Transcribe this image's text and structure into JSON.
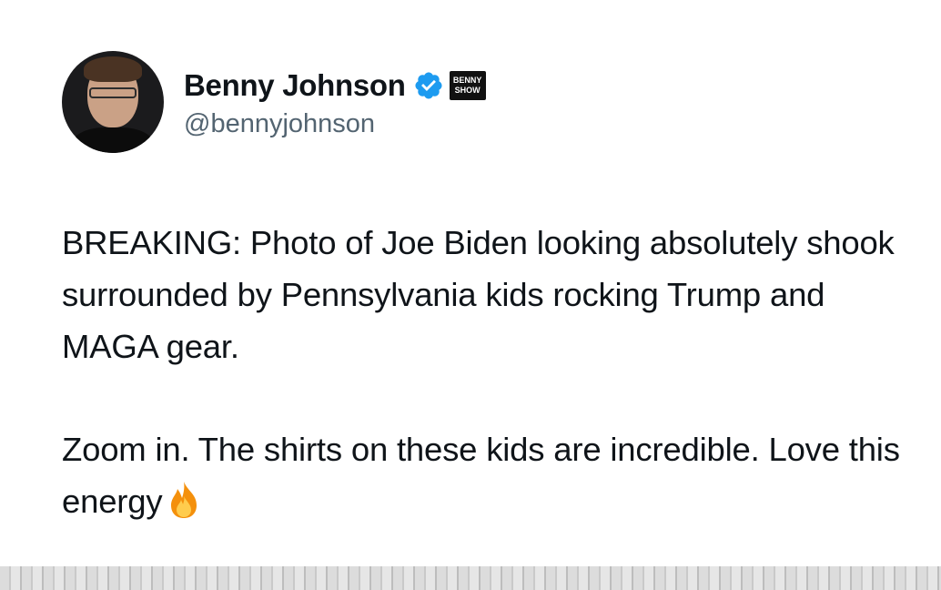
{
  "author": {
    "display_name": "Benny Johnson",
    "handle": "@bennyjohnson",
    "verified": true,
    "affiliate_badge_lines": [
      "BENNY",
      "SHOW"
    ]
  },
  "tweet": {
    "paragraphs": [
      "BREAKING: Photo of Joe Biden looking absolutely shook surrounded by Pennsylvania kids rocking Trump and MAGA gear.",
      "Zoom in. The shirts on these kids are incredible. Love this energy"
    ],
    "trailing_emoji": "fire-emoji"
  },
  "media": {
    "icon": "attached-photo-preview"
  },
  "colors": {
    "text": "#0f1419",
    "handle": "#536471",
    "verified_badge": "#1d9bf0",
    "background": "#ffffff"
  }
}
